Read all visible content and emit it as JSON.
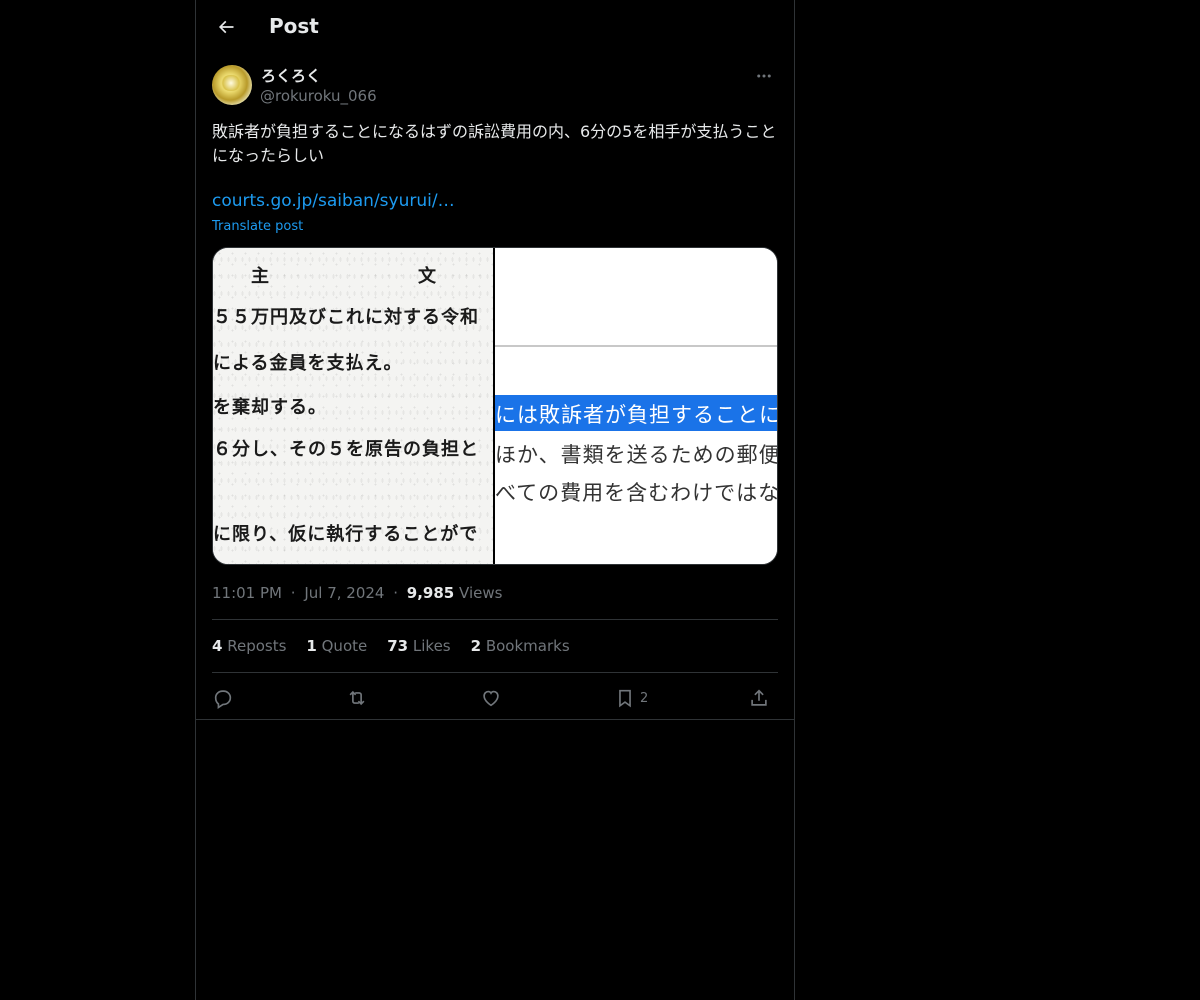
{
  "header": {
    "title": "Post",
    "back_icon": "arrow-left-icon"
  },
  "author": {
    "name": "ろくろく",
    "handle": "@rokuroku_066"
  },
  "post": {
    "text": "敗訴者が負担することになるはずの訴訟費用の内、6分の5を相手が支払うことになったらしい",
    "link_text": "courts.go.jp/saiban/syurui/…",
    "translate_label": "Translate post"
  },
  "media": {
    "left_image": {
      "heading_1": "主",
      "heading_2": "文",
      "lines": [
        "５５万円及びこれに対する令和",
        "による金員を支払え。",
        "を棄却する。",
        "６分し、その５を原告の負担と",
        "",
        "に限り、仮に執行することがで"
      ]
    },
    "right_image": {
      "highlighted": "には敗訴者が負担することにな",
      "lines": [
        "ほか、書類を送るための郵便",
        "べての費用を含むわけではな"
      ]
    }
  },
  "meta": {
    "time": "11:01 PM",
    "date": "Jul 7, 2024",
    "views_count": "9,985",
    "views_label": "Views",
    "separator": "·"
  },
  "stats": {
    "reposts_count": "4",
    "reposts_label": "Reposts",
    "quotes_count": "1",
    "quotes_label": "Quote",
    "likes_count": "73",
    "likes_label": "Likes",
    "bookmarks_count": "2",
    "bookmarks_label": "Bookmarks"
  },
  "actions": {
    "reply_icon": "reply-icon",
    "repost_icon": "repost-icon",
    "like_icon": "heart-icon",
    "bookmark_icon": "bookmark-icon",
    "bookmark_count": "2",
    "share_icon": "share-icon"
  },
  "colors": {
    "background": "#000000",
    "text": "#e7e9ea",
    "muted": "#71767b",
    "accent": "#1d9bf0",
    "border": "#2f3336"
  }
}
